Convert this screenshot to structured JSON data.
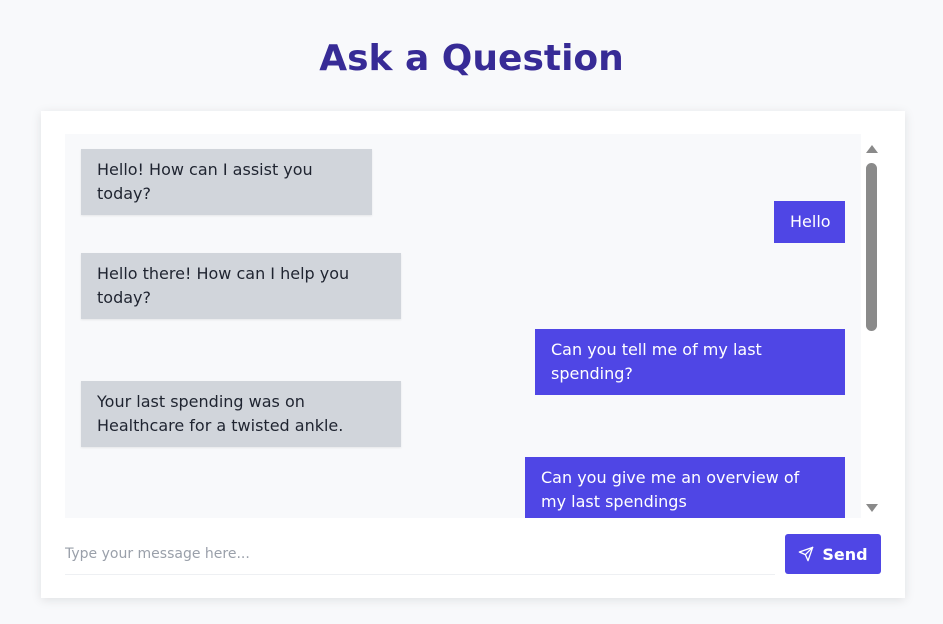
{
  "page": {
    "title": "Ask a Question"
  },
  "chat": {
    "messages": [
      {
        "role": "bot",
        "text": "Hello! How can I assist you today?"
      },
      {
        "role": "user",
        "text": "Hello"
      },
      {
        "role": "bot",
        "text": "Hello there! How can I help you today?"
      },
      {
        "role": "user",
        "text": "Can you tell me of my last spending?"
      },
      {
        "role": "bot",
        "text": "Your last spending was on Healthcare for a twisted ankle."
      },
      {
        "role": "user",
        "text": "Can you give me an overview of my last spendings"
      }
    ]
  },
  "composer": {
    "placeholder": "Type your message here...",
    "value": "",
    "send_label": "Send",
    "send_icon": "paper-plane-icon"
  },
  "colors": {
    "title": "#372b96",
    "accent": "#4f46e5",
    "bot_bubble": "#d1d5db",
    "background": "#f8f9fb"
  }
}
